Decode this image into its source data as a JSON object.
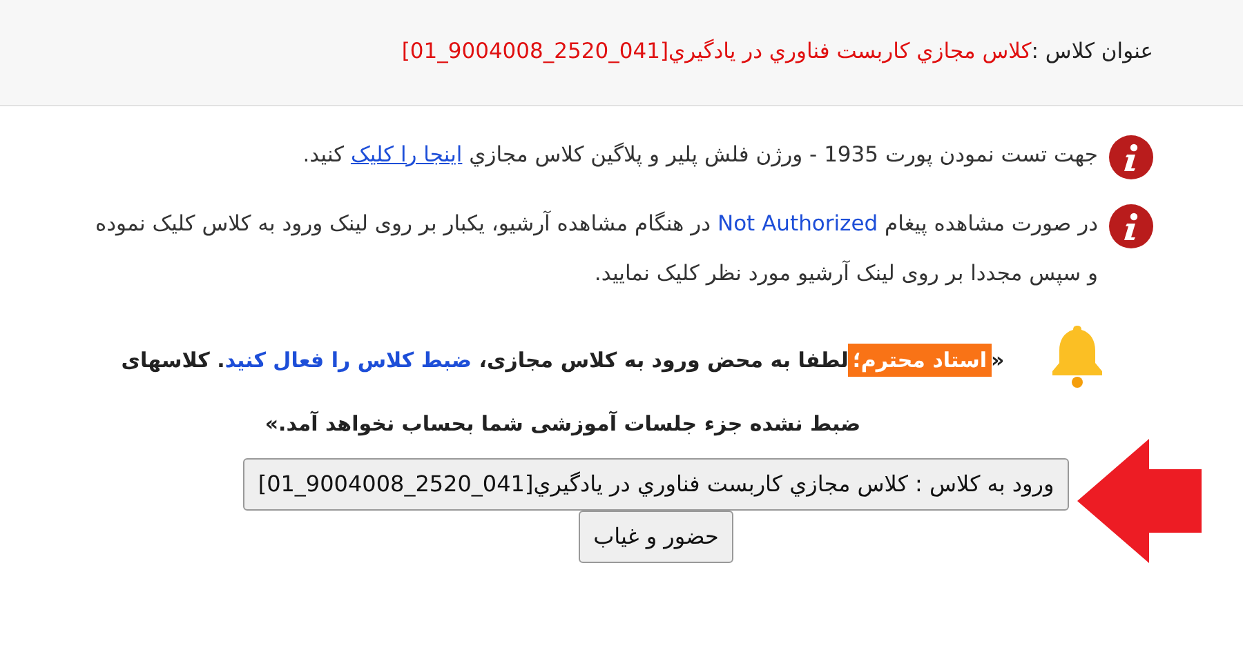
{
  "header": {
    "label": "عنوان کلاس :",
    "class_title": "کلاس مجازي کاربست فناوري در يادگيري[041_2520_9004008_01]"
  },
  "notices": [
    {
      "kind": "info",
      "parts": [
        {
          "text": "جهت تست نمودن پورت 1935 - ورژن فلش پلیر و پلاگین کلاس مجازي "
        },
        {
          "text": "اینجا را کلیک",
          "link": true
        },
        {
          "text": " کنید."
        }
      ]
    },
    {
      "kind": "info",
      "parts": [
        {
          "text": "در صورت مشاهده پیغام "
        },
        {
          "text": "Not Authorized",
          "highlight": true
        },
        {
          "text": " در هنگام مشاهده آرشیو، یکبار بر روی لینک ورود به کلاس کلیک نموده و سپس مجددا بر روی لینک آرشیو مورد نظر کلیک نمایید."
        }
      ]
    }
  ],
  "alert": {
    "open_quote": "«",
    "badge": "استاد محترم؛",
    "text_1": "لطفا به محض ورود به کلاس مجازی، ",
    "emphasis": "ضبط کلاس را فعال کنید",
    "text_2": ". کلاسهای ضبط نشده جزء جلسات آموزشی شما بحساب نخواهد آمد.»"
  },
  "buttons": [
    {
      "label": "ورود به کلاس : کلاس مجازي کاربست فناوري در يادگيري[041_2520_9004008_01]"
    },
    {
      "label": "حضور و غیاب"
    }
  ]
}
